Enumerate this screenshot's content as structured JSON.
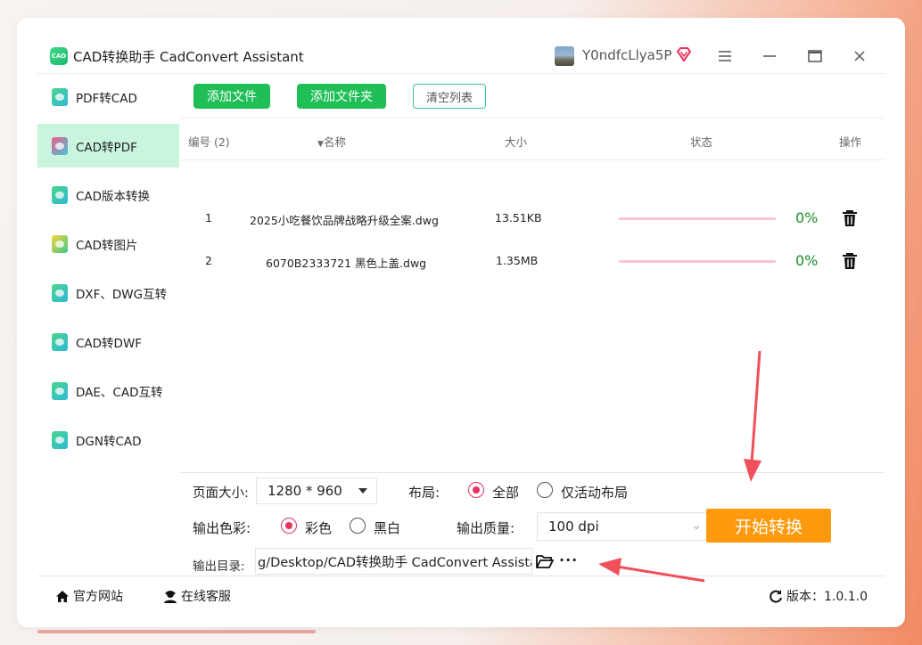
{
  "app": {
    "logo_text": "CAD",
    "title": "CAD转换助手 CadConvert Assistant",
    "username": "Y0ndfcLlya5P"
  },
  "sidebar": {
    "items": [
      {
        "label": "PDF转CAD",
        "active": false
      },
      {
        "label": "CAD转PDF",
        "active": true
      },
      {
        "label": "CAD版本转换",
        "active": false
      },
      {
        "label": "CAD转图片",
        "active": false
      },
      {
        "label": "DXF、DWG互转",
        "active": false
      },
      {
        "label": "CAD转DWF",
        "active": false
      },
      {
        "label": "DAE、CAD互转",
        "active": false
      },
      {
        "label": "DGN转CAD",
        "active": false
      }
    ]
  },
  "toolbar": {
    "add_file": "添加文件",
    "add_folder": "添加文件夹",
    "clear_list": "清空列表"
  },
  "table": {
    "headers": {
      "number": "编号 (2)",
      "name": "名称",
      "size": "大小",
      "status": "状态",
      "action": "操作"
    },
    "rows": [
      {
        "index": "1",
        "name": "2025小吃餐饮品牌战略升级全案.dwg",
        "size": "13.51KB",
        "progress": 0,
        "percent": "0%"
      },
      {
        "index": "2",
        "name": "6070B2333721 黑色上盖.dwg",
        "size": "1.35MB",
        "progress": 0,
        "percent": "0%"
      }
    ]
  },
  "options": {
    "page_size_label": "页面大小:",
    "page_size_value": "1280 * 960",
    "layout_label": "布局:",
    "layout_all": "全部",
    "layout_active": "仅活动布局",
    "color_label": "输出色彩:",
    "color_color": "彩色",
    "color_bw": "黑白",
    "quality_label": "输出质量:",
    "quality_value": "100 dpi",
    "outdir_label": "输出目录:",
    "outdir_value": "g/Desktop/CAD转换助手 CadConvert Assistant",
    "more": "···"
  },
  "start_button": "开始转换",
  "footer": {
    "website": "官方网站",
    "support": "在线客服",
    "version": "版本：1.0.1.0"
  },
  "colors": {
    "green": "#1fbe56",
    "orange": "#ff9a0f",
    "accent_red": "#e8335e",
    "active_bg": "#c9f5df",
    "progress_track": "#f6c5d1",
    "percent_text": "#1a8f2c",
    "annotation_arrow": "#f0505a"
  }
}
